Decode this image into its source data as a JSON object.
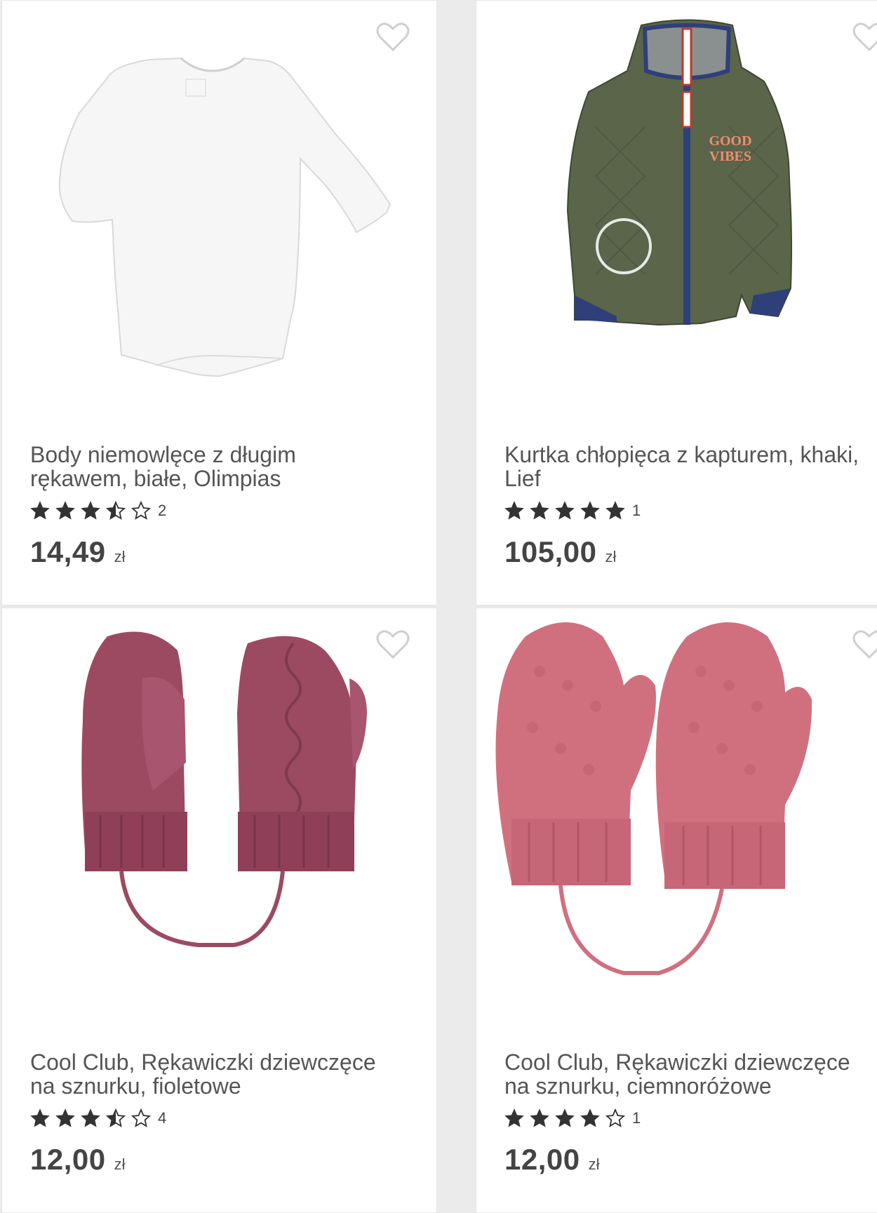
{
  "products": [
    {
      "name": "Body niemowlęce z długim\nrękawem, białe, Olimpias",
      "rating": 3.5,
      "rating_count": "2",
      "price": "14,49",
      "currency": "zł",
      "image_icon": "white-baby-bodysuit"
    },
    {
      "name": "Kurtka chłopięca z kapturem, khaki,\nLief",
      "rating": 5,
      "rating_count": "1",
      "price": "105,00",
      "currency": "zł",
      "image_icon": "khaki-quilted-jacket",
      "jacket_text_1": "GOOD",
      "jacket_text_2": "VIBES"
    },
    {
      "name": "Cool Club, Rękawiczki dziewczęce\nna sznurku, fioletowe",
      "rating": 3.5,
      "rating_count": "4",
      "price": "12,00",
      "currency": "zł",
      "image_icon": "purple-knitted-mittens"
    },
    {
      "name": "Cool Club, Rękawiczki dziewczęce\nna sznurku, ciemnoróżowe",
      "rating": 4,
      "rating_count": "1",
      "price": "12,00",
      "currency": "zł",
      "image_icon": "pink-knitted-mittens"
    }
  ],
  "colors": {
    "star": "#333333",
    "heart_outline": "#cfcfcf",
    "jacket_khaki": "#5a6549",
    "jacket_navy": "#2e3f7a",
    "mitten_purple": "#9c4a62",
    "mitten_pink": "#d0707f"
  }
}
